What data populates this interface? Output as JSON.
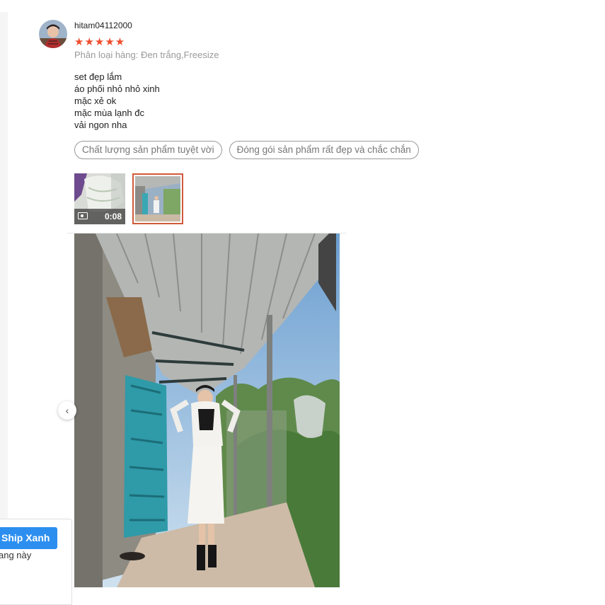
{
  "review": {
    "username": "hitam04112000",
    "stars": "★★★★★",
    "rating": 5,
    "variation": "Phân loại hàng: Đen trắng,Freesize",
    "comment_lines": [
      "set đẹp lắm",
      "áo phối nhỏ nhỏ xinh",
      "mặc xẻ ok",
      "mặc mùa lạnh đc",
      "vải ngon nha"
    ],
    "tags": [
      "Chất lượng sản phẩm tuyệt vời",
      "Đóng gói sản phẩm rất đẹp và chắc chắn"
    ],
    "video_duration": "0:08",
    "icons": {
      "video": "video-camera-icon",
      "prev": "chevron-left-icon",
      "star": "star-icon"
    },
    "colors": {
      "star": "#ee4d2d",
      "selected_border": "#d0593a",
      "promo_button": "#2c8ff0"
    }
  },
  "promo": {
    "button_label": "Ship Xanh",
    "text": "ang này"
  },
  "prev_glyph": "‹"
}
